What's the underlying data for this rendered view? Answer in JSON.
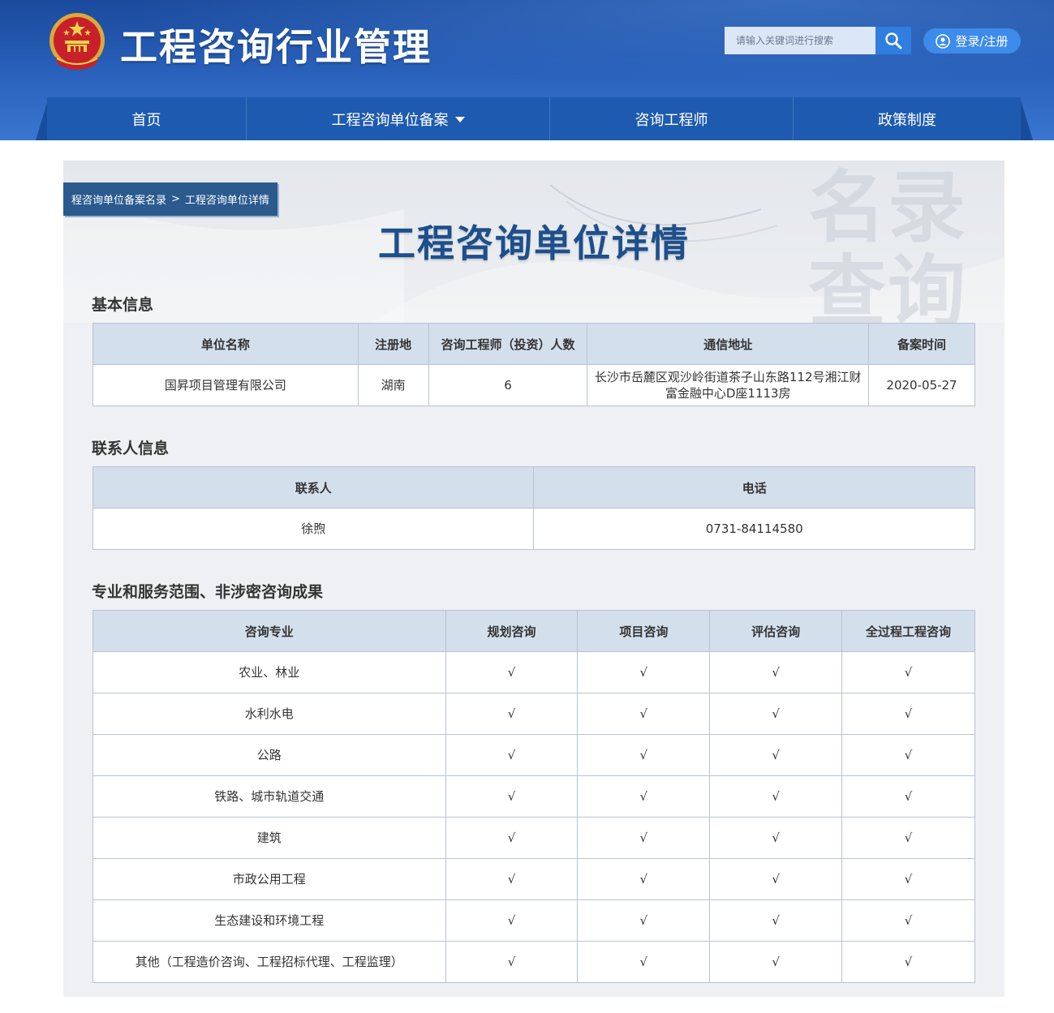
{
  "header": {
    "site_title": "工程咨询行业管理",
    "search_placeholder": "请输入关键词进行搜索",
    "login_label": "登录/注册"
  },
  "nav": {
    "items": [
      {
        "label": "首页"
      },
      {
        "label": "工程咨询单位备案"
      },
      {
        "label": "咨询工程师"
      },
      {
        "label": "政策制度"
      }
    ]
  },
  "breadcrumb": {
    "parent": "程咨询单位备案名录",
    "separator": ">",
    "current": "工程咨询单位详情"
  },
  "page": {
    "title": "工程咨询单位详情",
    "watermark_line1": "名录",
    "watermark_line2": "查询"
  },
  "basic_info": {
    "title": "基本信息",
    "headers": [
      "单位名称",
      "注册地",
      "咨询工程师（投资）人数",
      "通信地址",
      "备案时间"
    ],
    "row": [
      "国昇项目管理有限公司",
      "湖南",
      "6",
      "长沙市岳麓区观沙岭街道茶子山东路112号湘江财富金融中心D座1113房",
      "2020-05-27"
    ]
  },
  "contact_info": {
    "title": "联系人信息",
    "headers": [
      "联系人",
      "电话"
    ],
    "row": [
      "徐煦",
      "0731-84114580"
    ]
  },
  "scope": {
    "title": "专业和服务范围、非涉密咨询成果",
    "headers": [
      "咨询专业",
      "规划咨询",
      "项目咨询",
      "评估咨询",
      "全过程工程咨询"
    ],
    "rows": [
      [
        "农业、林业",
        "√",
        "√",
        "√",
        "√"
      ],
      [
        "水利水电",
        "√",
        "√",
        "√",
        "√"
      ],
      [
        "公路",
        "√",
        "√",
        "√",
        "√"
      ],
      [
        "铁路、城市轨道交通",
        "√",
        "√",
        "√",
        "√"
      ],
      [
        "建筑",
        "√",
        "√",
        "√",
        "√"
      ],
      [
        "市政公用工程",
        "√",
        "√",
        "√",
        "√"
      ],
      [
        "生态建设和环境工程",
        "√",
        "√",
        "√",
        "√"
      ],
      [
        "其他（工程造价咨询、工程招标代理、工程监理）",
        "√",
        "√",
        "√",
        "√"
      ]
    ]
  }
}
